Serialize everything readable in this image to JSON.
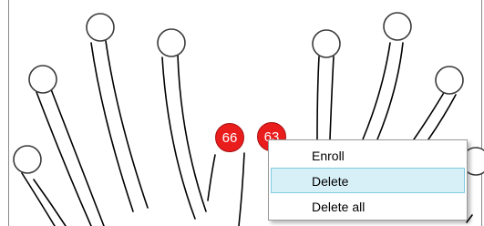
{
  "fingers": {
    "left_hand": [
      "left-little",
      "left-ring",
      "left-middle",
      "left-index",
      "left-thumb"
    ],
    "right_hand": [
      "right-thumb",
      "right-index",
      "right-middle",
      "right-ring",
      "right-little"
    ]
  },
  "badges": {
    "left_thumb": "66",
    "right_thumb": "63"
  },
  "colors": {
    "badge": "#ea1d1d",
    "menu_highlight": "#d7f0f8"
  },
  "context_menu": {
    "items": [
      {
        "label": "Enroll"
      },
      {
        "label": "Delete"
      },
      {
        "label": "Delete all"
      }
    ],
    "highlighted_index": 1
  }
}
